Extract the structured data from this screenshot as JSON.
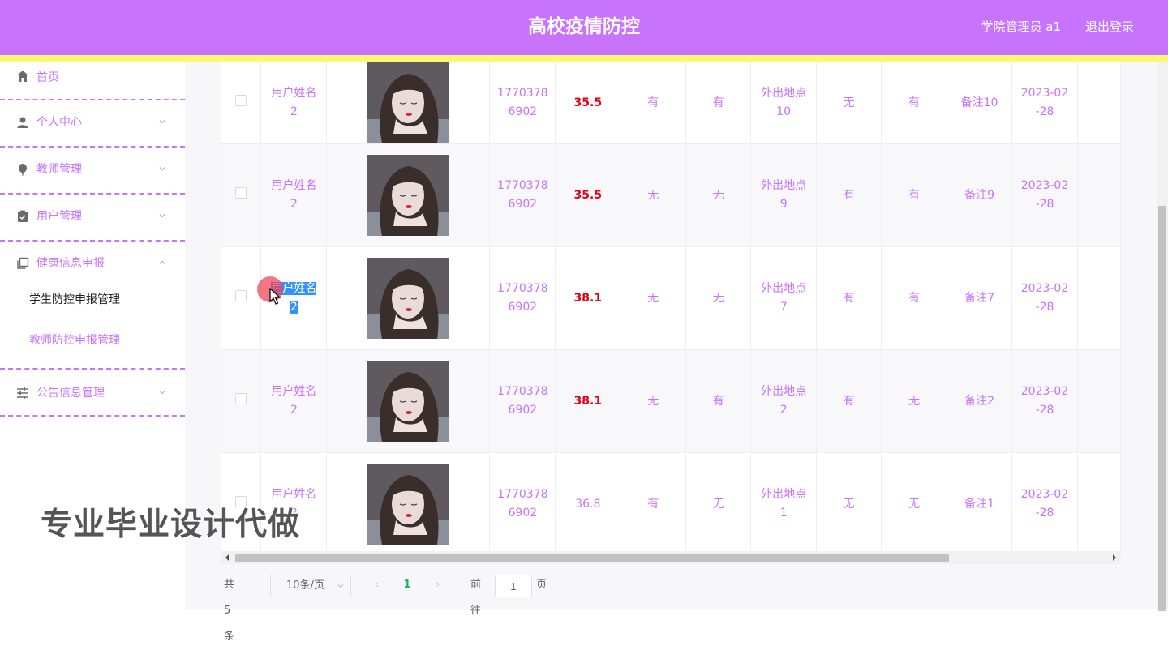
{
  "header": {
    "title": "高校疫情防控",
    "user": "学院管理员 a1",
    "logout": "退出登录"
  },
  "sidebar": {
    "items": [
      {
        "label": "首页",
        "icon": "home-icon"
      },
      {
        "label": "个人中心",
        "icon": "person-icon"
      },
      {
        "label": "教师管理",
        "icon": "balloon-icon"
      },
      {
        "label": "用户管理",
        "icon": "clipboard-icon"
      },
      {
        "label": "健康信息申报",
        "icon": "copy-icon"
      },
      {
        "label": "公告信息管理",
        "icon": "sliders-icon"
      }
    ],
    "submenu": [
      {
        "label": "学生防控申报管理"
      },
      {
        "label": "教师防控申报管理"
      }
    ]
  },
  "rows": [
    {
      "name": [
        "用户姓名",
        "2"
      ],
      "phone": [
        "1770378",
        "6902"
      ],
      "temp": "35.5",
      "high": true,
      "c1": "有",
      "c2": "有",
      "place": [
        "外出地点",
        "10"
      ],
      "c3": "无",
      "c4": "有",
      "note": "备注10",
      "date": [
        "2023-02",
        "-28"
      ]
    },
    {
      "name": [
        "用户姓名",
        "2"
      ],
      "phone": [
        "1770378",
        "6902"
      ],
      "temp": "35.5",
      "high": true,
      "c1": "无",
      "c2": "无",
      "place": [
        "外出地点",
        "9"
      ],
      "c3": "有",
      "c4": "有",
      "note": "备注9",
      "date": [
        "2023-02",
        "-28"
      ]
    },
    {
      "name": [
        "用户姓名",
        "2"
      ],
      "phone": [
        "1770378",
        "6902"
      ],
      "temp": "38.1",
      "high": true,
      "c1": "无",
      "c2": "无",
      "place": [
        "外出地点",
        "7"
      ],
      "c3": "有",
      "c4": "有",
      "note": "备注7",
      "date": [
        "2023-02",
        "-28"
      ]
    },
    {
      "name": [
        "用户姓名",
        "2"
      ],
      "phone": [
        "1770378",
        "6902"
      ],
      "temp": "38.1",
      "high": true,
      "c1": "无",
      "c2": "有",
      "place": [
        "外出地点",
        "2"
      ],
      "c3": "有",
      "c4": "无",
      "note": "备注2",
      "date": [
        "2023-02",
        "-28"
      ]
    },
    {
      "name": [
        "用户姓名",
        "2"
      ],
      "phone": [
        "1770378",
        "6902"
      ],
      "temp": "36.8",
      "high": false,
      "c1": "有",
      "c2": "无",
      "place": [
        "外出地点",
        "1"
      ],
      "c3": "无",
      "c4": "无",
      "note": "备注1",
      "date": [
        "2023-02",
        "-28"
      ]
    }
  ],
  "pager": {
    "total": "共 5 条",
    "size": "10条/页",
    "prev": "‹",
    "page": "1",
    "next": "›",
    "goto": "前往",
    "goto_value": "1",
    "unit": "页"
  },
  "watermark": "专业毕业设计代做",
  "colors": {
    "accent": "#c873fb",
    "topbar_stripe": "#f9f871",
    "high_temp": "#e60012"
  }
}
